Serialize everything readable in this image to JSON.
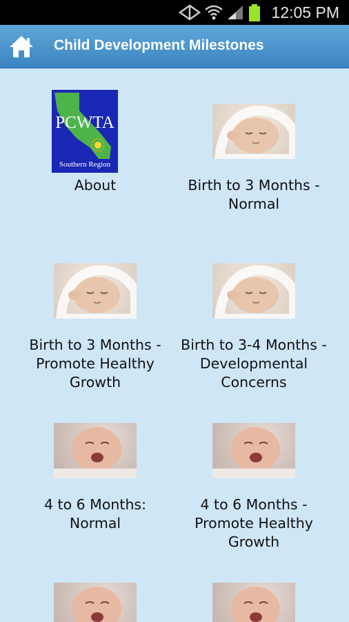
{
  "status_bar": {
    "time": "12:05 PM"
  },
  "app_bar": {
    "title": "Child Development Milestones"
  },
  "logo": {
    "brand": "PCWTA",
    "region": "Southern Region"
  },
  "tiles": [
    {
      "label": "About",
      "image": "pcwta-logo"
    },
    {
      "label": "Birth to 3 Months -\nNormal",
      "image": "sleeping-baby"
    },
    {
      "label": "Birth to 3 Months -\nPromote Healthy\nGrowth",
      "image": "sleeping-baby"
    },
    {
      "label": "Birth to 3-4 Months -\nDevelopmental\nConcerns",
      "image": "sleeping-baby"
    },
    {
      "label": "4 to 6 Months:\nNormal",
      "image": "crying-baby"
    },
    {
      "label": "4 to 6 Months -\nPromote Healthy\nGrowth",
      "image": "crying-baby"
    },
    {
      "label": "",
      "image": "crying-baby"
    },
    {
      "label": "",
      "image": "crying-baby"
    }
  ],
  "colors": {
    "background": "#cfe6f7",
    "app_bar": "#4b95cd",
    "status_bar": "#000000"
  }
}
